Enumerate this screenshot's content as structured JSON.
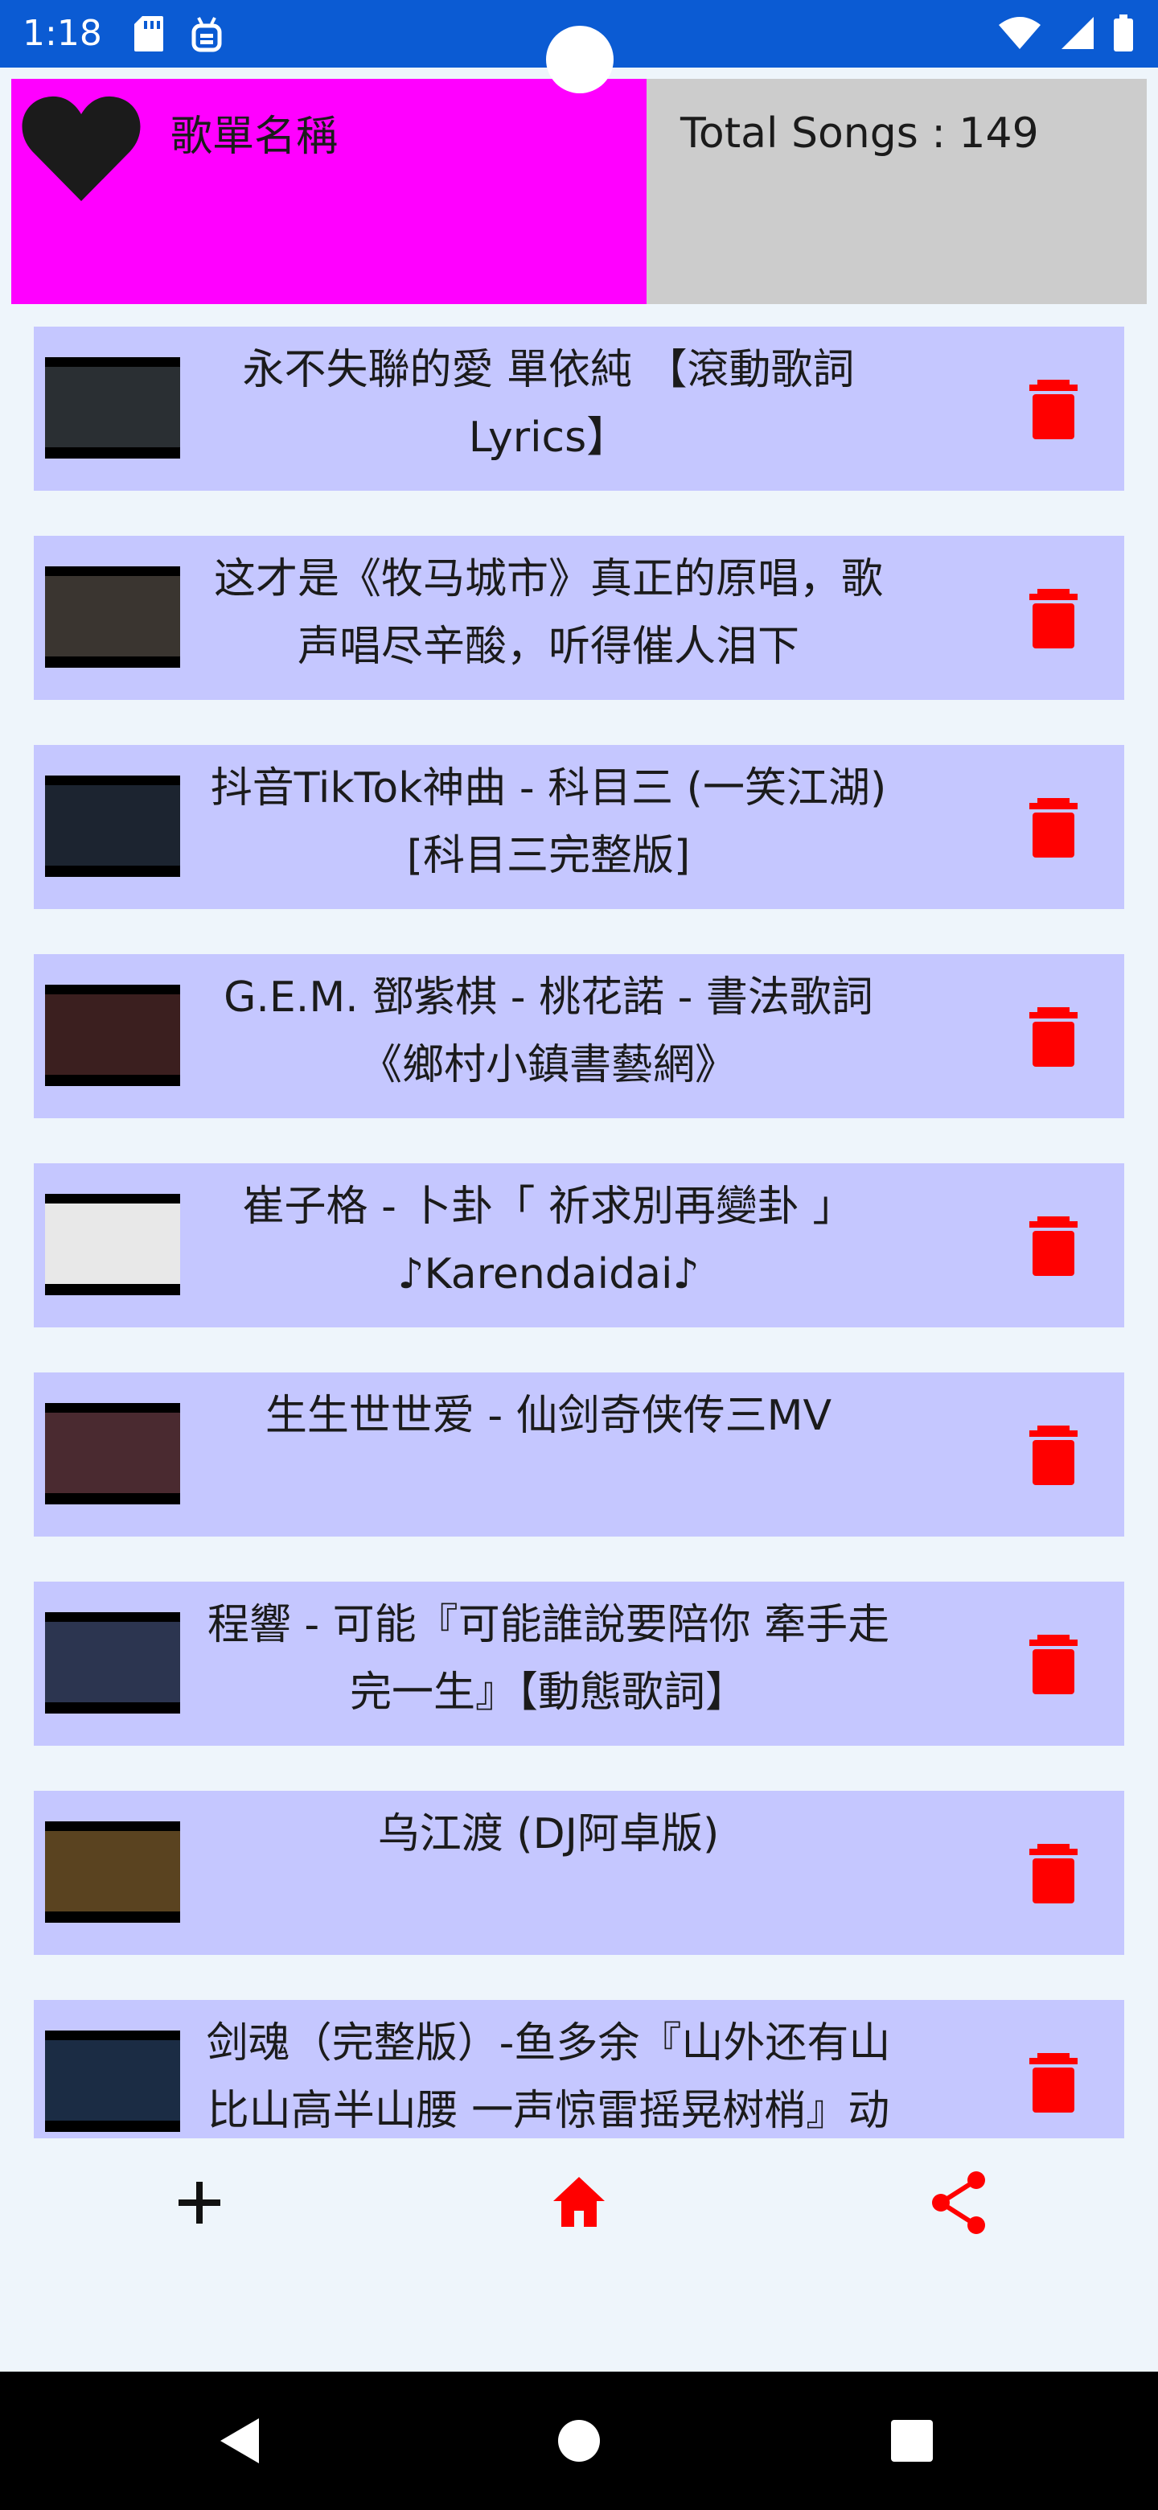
{
  "status_bar": {
    "time": "1:18",
    "left_icons": [
      "sd-card-icon",
      "android-debug-icon"
    ],
    "right_icons": [
      "wifi-icon",
      "signal-icon",
      "battery-icon"
    ]
  },
  "header": {
    "playlist_name": "歌單名稱",
    "total_songs": "Total Songs : 149",
    "colors": {
      "left_bg": "#ff00ff",
      "right_bg": "#cccccc"
    }
  },
  "songs": [
    {
      "title": "永不失聯的愛 單依純 【滾動歌詞 Lyrics】",
      "thumb_color": "#2a2f33"
    },
    {
      "title": "这才是《牧马城市》真正的原唱，歌声唱尽辛酸，听得催人泪下",
      "thumb_color": "#3a3530"
    },
    {
      "title": "抖音TikTok神曲 - 科目三 (一笑江湖) [科目三完整版]",
      "thumb_color": "#1c2430"
    },
    {
      "title": "G.E.M. 鄧紫棋 - 桃花諾 - 書法歌詞 《鄉村小鎮書藝網》",
      "thumb_color": "#3b1f1f"
    },
    {
      "title": "崔子格 - 卜卦「 祈求別再變卦 」 ♪Karendaidai♪",
      "thumb_color": "#e8e8e8"
    },
    {
      "title": "生生世世爱 - 仙剑奇侠传三MV",
      "thumb_color": "#4a2a30"
    },
    {
      "title": "程響 - 可能『可能誰說要陪你 牽手走完一生』【動態歌詞】",
      "thumb_color": "#2c3550"
    },
    {
      "title": "乌江渡 (DJ阿卓版)",
      "thumb_color": "#5a4320"
    },
    {
      "title": "剑魂（完整版）-鱼多余『山外还有山 比山高半山腰 一声惊雷摇晃树梢』动",
      "thumb_color": "#1b2c44"
    }
  ],
  "bottom_bar": {
    "add_icon": "plus-icon",
    "home_icon": "home-icon",
    "share_icon": "share-icon"
  },
  "nav_bar": {
    "back_icon": "back-triangle-icon",
    "home_icon": "home-circle-icon",
    "recents_icon": "recents-square-icon"
  },
  "colors": {
    "accent_red": "#ff0000",
    "card_bg": "#c5c7ff",
    "status_bar": "#0b5bd3"
  }
}
